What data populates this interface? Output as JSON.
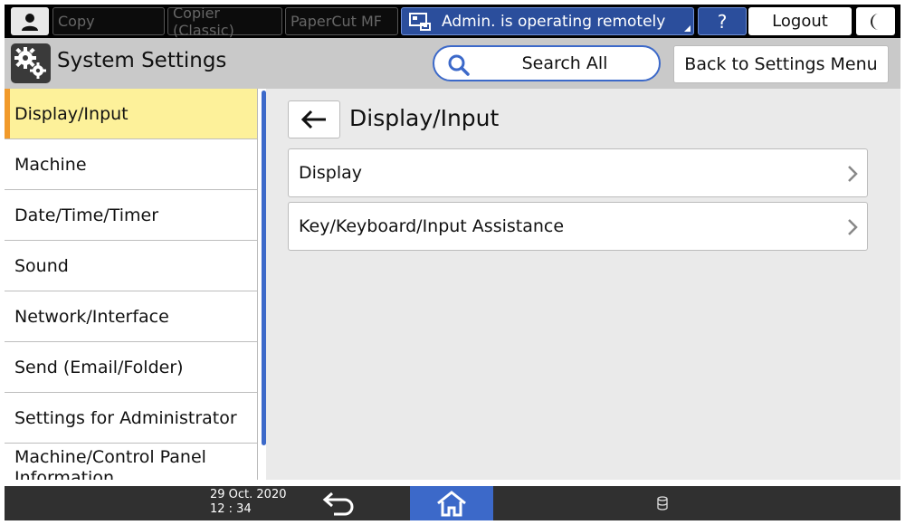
{
  "topbar": {
    "tabs": [
      "Copy",
      "Copier (Classic)",
      "PaperCut MF"
    ],
    "remote_status": "Admin. is operating remotely",
    "help_label": "?",
    "logout_label": "Logout"
  },
  "header": {
    "title": "System Settings",
    "search_label": "Search All",
    "back_label": "Back to Settings Menu"
  },
  "sidebar": {
    "items": [
      {
        "label": "Display/Input"
      },
      {
        "label": "Machine"
      },
      {
        "label": "Date/Time/Timer"
      },
      {
        "label": "Sound"
      },
      {
        "label": "Network/Interface"
      },
      {
        "label": "Send (Email/Folder)"
      },
      {
        "label": "Settings for Administrator"
      },
      {
        "label": "Machine/Control Panel Information"
      }
    ],
    "active_index": 0
  },
  "main": {
    "title": "Display/Input",
    "rows": [
      {
        "label": "Display"
      },
      {
        "label": "Key/Keyboard/Input Assistance"
      }
    ]
  },
  "bottombar": {
    "date": "29 Oct. 2020",
    "time": "12 : 34"
  },
  "colors": {
    "accent_blue": "#3c69c9",
    "remote_blue": "#2b4e9c",
    "active_yellow": "#fdf19a",
    "active_marker": "#f19a2b"
  },
  "icons": {
    "user": "user-icon",
    "remote": "remote-operation-icon",
    "moon": "moon-icon",
    "system": "gears-icon",
    "search": "search-icon",
    "back": "arrow-left-icon",
    "chevron": "chevron-right-icon",
    "return": "return-icon",
    "home": "home-icon",
    "storage": "storage-icon"
  }
}
